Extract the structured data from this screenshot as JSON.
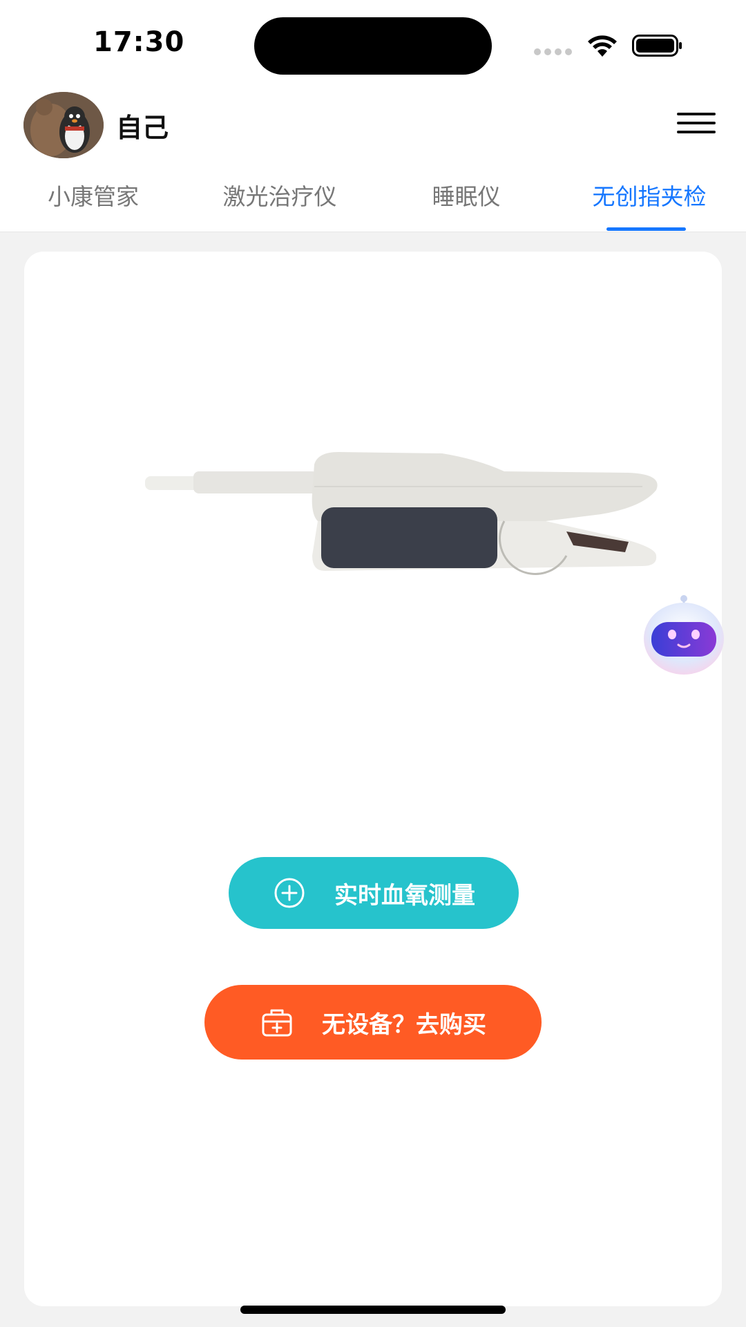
{
  "status_bar": {
    "time": "17:30"
  },
  "header": {
    "profile_name": "自己",
    "avatar_icon": "plush-toys-avatar",
    "menu_icon": "hamburger-menu-icon"
  },
  "tabs": [
    {
      "label": "小康管家",
      "active": false
    },
    {
      "label": "激光治疗仪",
      "active": false
    },
    {
      "label": "睡眠仪",
      "active": false
    },
    {
      "label": "无创指夹检",
      "active": true
    }
  ],
  "main": {
    "device_image_icon": "finger-clip-oximeter-sensor",
    "measure_button": {
      "label": "实时血氧测量",
      "icon": "plus-circle-icon",
      "color": "#26c3cc"
    },
    "buy_button": {
      "label": "无设备？去购买",
      "icon": "medical-kit-icon",
      "color": "#ff5b24"
    },
    "assistant_icon": "robot-assistant-icon"
  },
  "colors": {
    "accent": "#1677ff",
    "background": "#f2f2f2",
    "card": "#ffffff"
  }
}
